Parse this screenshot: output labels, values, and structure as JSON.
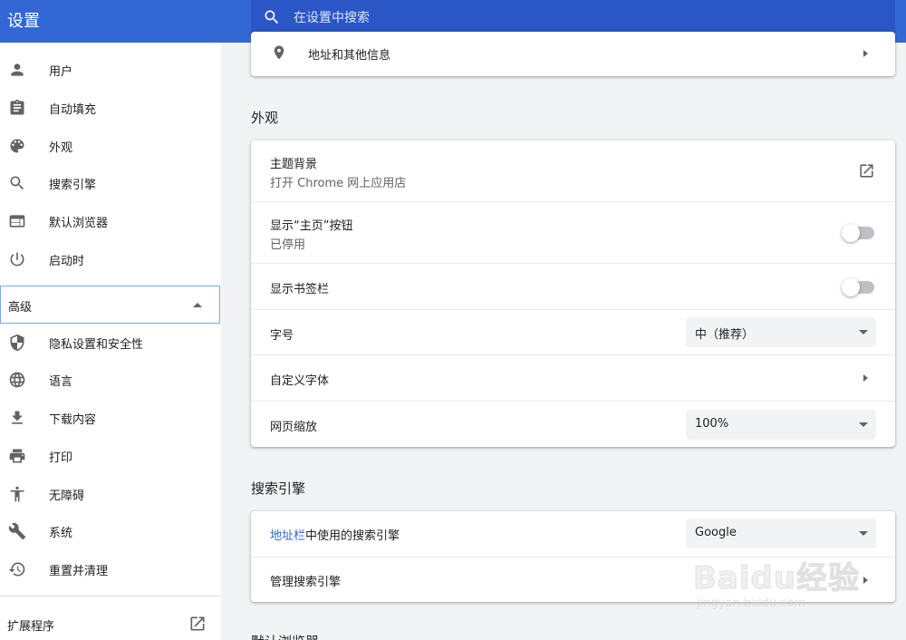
{
  "header": {
    "title": "设置",
    "search_placeholder": "在设置中搜索"
  },
  "sidebar": {
    "items": [
      {
        "label": "用户",
        "icon": "person-icon"
      },
      {
        "label": "自动填充",
        "icon": "clipboard-icon"
      },
      {
        "label": "外观",
        "icon": "palette-icon"
      },
      {
        "label": "搜索引擎",
        "icon": "search-icon"
      },
      {
        "label": "默认浏览器",
        "icon": "browser-icon"
      },
      {
        "label": "启动时",
        "icon": "power-icon"
      }
    ],
    "advanced_label": "高级",
    "advanced_items": [
      {
        "label": "隐私设置和安全性",
        "icon": "shield-icon"
      },
      {
        "label": "语言",
        "icon": "globe-icon"
      },
      {
        "label": "下载内容",
        "icon": "download-icon"
      },
      {
        "label": "打印",
        "icon": "print-icon"
      },
      {
        "label": "无障碍",
        "icon": "accessibility-icon"
      },
      {
        "label": "系统",
        "icon": "wrench-icon"
      },
      {
        "label": "重置并清理",
        "icon": "history-icon"
      }
    ],
    "extensions_label": "扩展程序"
  },
  "main": {
    "address_row_label": "地址和其他信息",
    "appearance": {
      "title": "外观",
      "theme_label": "主题背景",
      "theme_sub": "打开 Chrome 网上应用店",
      "home_button_label": "显示“主页”按钮",
      "home_button_sub": "已停用",
      "bookmarks_bar_label": "显示书签栏",
      "font_size_label": "字号",
      "font_size_value": "中（推荐）",
      "custom_fonts_label": "自定义字体",
      "page_zoom_label": "网页缩放",
      "page_zoom_value": "100%"
    },
    "search_engine": {
      "title": "搜索引擎",
      "link_text": "地址栏",
      "label_rest": "中使用的搜索引擎",
      "value": "Google",
      "manage_label": "管理搜索引擎"
    },
    "next_section_title": "默认浏览器"
  },
  "watermark": {
    "text": "Baidu经验",
    "sub": "jingyan.baidu.com"
  },
  "colors": {
    "header": "#3367d6",
    "search_box": "#2a56c6",
    "background": "#f1f3f4",
    "link": "#3367d6"
  }
}
